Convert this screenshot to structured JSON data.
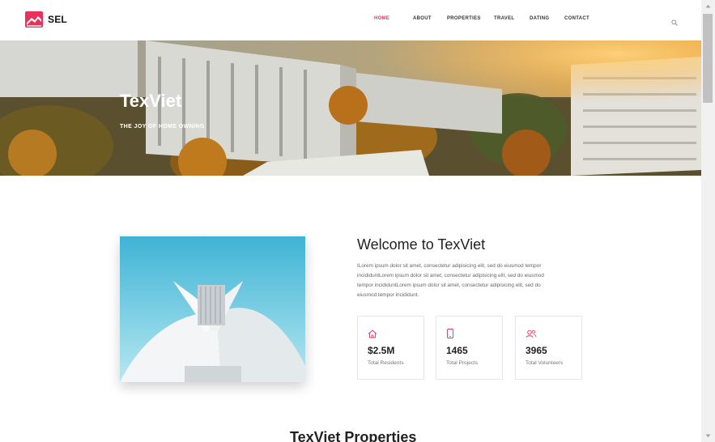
{
  "brand": {
    "name": "SEL",
    "accent": "#e8325a"
  },
  "nav": {
    "items": [
      {
        "label": "HOME",
        "active": true
      },
      {
        "label": "ABOUT",
        "active": false
      },
      {
        "label": "PROPERTIES",
        "active": false
      },
      {
        "label": "TRAVEL",
        "active": false
      },
      {
        "label": "DATING",
        "active": false
      },
      {
        "label": "CONTACT",
        "active": false
      }
    ],
    "search_icon": "search-icon"
  },
  "hero": {
    "title": "TexViet",
    "subtitle": "THE JOY OF HOME OWNING"
  },
  "welcome": {
    "title": "Welcome to TexViet",
    "body": "ILorem ipsum dolor sit amet, consectetur adipisicing elit, sed do eiusmod tempor incididuntLorem ipsum dolor sit amet, consectetur adipisicing elit, sed do eiusmod tempor incididuntLorem ipsum dolor sit amet, consectetur adipisicing elit, sed do eiusmod tempor incididunt."
  },
  "stats": [
    {
      "icon": "home-icon",
      "value": "$2.5M",
      "label": "Total Residents"
    },
    {
      "icon": "mobile-icon",
      "value": "1465",
      "label": "Total Projects"
    },
    {
      "icon": "users-icon",
      "value": "3965",
      "label": "Total Volunteers"
    }
  ],
  "properties": {
    "title": "TexViet Properties"
  }
}
